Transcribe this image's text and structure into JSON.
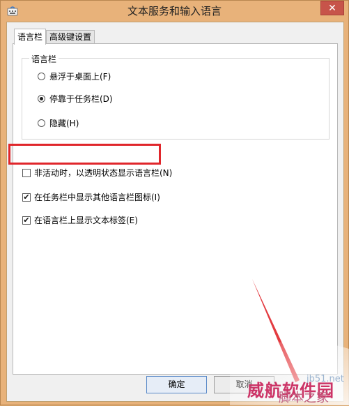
{
  "window": {
    "title": "文本服务和输入语言",
    "close_glyph": "✕",
    "icon": "keyboard-icon"
  },
  "tabs": [
    {
      "label": "语言栏",
      "active": true
    },
    {
      "label": "高级键设置",
      "active": false
    }
  ],
  "language_bar_group": {
    "legend": "语言栏",
    "options": [
      {
        "label": "悬浮于桌面上(F)",
        "selected": false
      },
      {
        "label": "停靠于任务栏(D)",
        "selected": true
      },
      {
        "label": "隐藏(H)",
        "selected": false
      }
    ]
  },
  "checkboxes": [
    {
      "label": "非活动时，以透明状态显示语言栏(N)",
      "checked": false
    },
    {
      "label": "在任务栏中显示其他语言栏图标(I)",
      "checked": true
    },
    {
      "label": "在语言栏上显示文本标签(E)",
      "checked": true
    }
  ],
  "buttons": {
    "ok_label": "确定",
    "cancel_label": "取消"
  },
  "watermark": {
    "site_text": "jb51.net",
    "brand_text": "威航软件园",
    "brand_sub": "脚本之家"
  },
  "colors": {
    "highlight": "#e0262b",
    "arrow": "#e0262b",
    "frame": "#e8b27a"
  }
}
